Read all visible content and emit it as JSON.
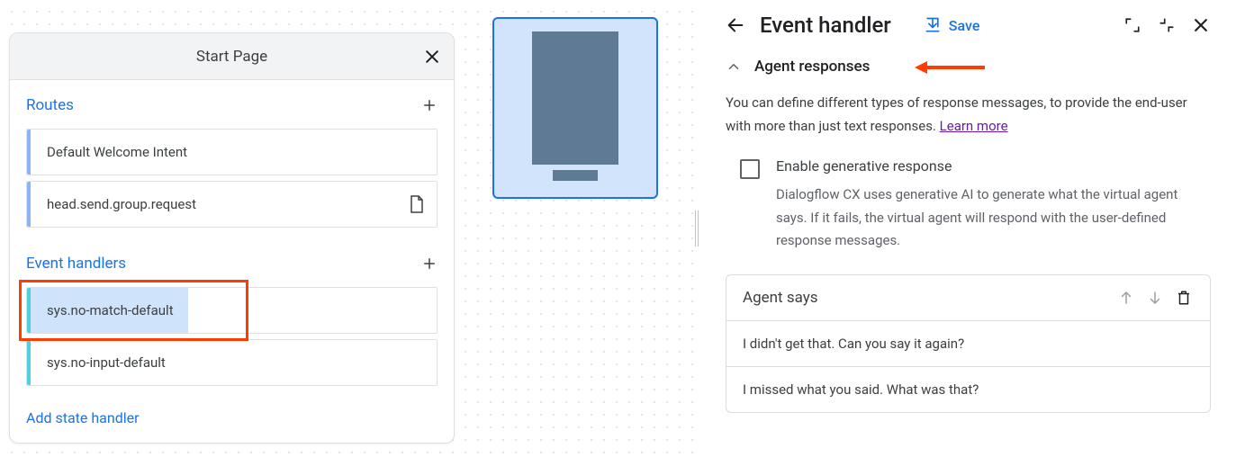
{
  "page": {
    "title": "Start Page",
    "routes_label": "Routes",
    "event_handlers_label": "Event handlers",
    "add_state_label": "Add state handler",
    "routes": [
      {
        "label": "Default Welcome Intent",
        "has_doc": false
      },
      {
        "label": "head.send.group.request",
        "has_doc": true
      }
    ],
    "events": [
      {
        "label": "sys.no-match-default",
        "selected": true
      },
      {
        "label": "sys.no-input-default",
        "selected": false
      }
    ]
  },
  "panel": {
    "title": "Event handler",
    "save_label": "Save",
    "section_title": "Agent responses",
    "description_part1": "You can define different types of response messages, to provide the end-user with more than just text responses. ",
    "learn_more": "Learn more",
    "checkbox": {
      "label": "Enable generative response",
      "desc": "Dialogflow CX uses generative AI to generate what the virtual agent says. If it fails, the virtual agent will respond with the user-defined response messages."
    },
    "responses": {
      "header": "Agent says",
      "items": [
        "I didn't get that. Can you say it again?",
        "I missed what you said. What was that?"
      ]
    }
  }
}
